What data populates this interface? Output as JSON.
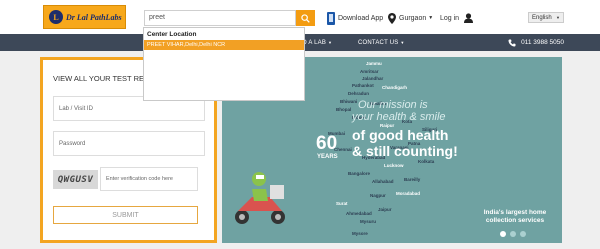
{
  "header": {
    "logo_text": "Dr Lal PathLabs",
    "search_value": "preet",
    "download_label": "Download App",
    "location_label": "Gurgaon",
    "login_label": "Log in",
    "language_selected": "English"
  },
  "dropdown": {
    "heading": "Center Location",
    "items": [
      "PREET VIHAR,Delhi,Delhi NCR"
    ]
  },
  "nav": {
    "items": [
      "O A LAB",
      "CONTACT US"
    ],
    "phone": "011 3988 5050"
  },
  "report_form": {
    "title": "VIEW ALL YOUR TEST REPORTS",
    "lab_placeholder": "Lab / Visit ID",
    "password_placeholder": "Password",
    "captcha_text": "QWGUSV",
    "captcha_placeholder": "Enter verification code here",
    "submit_label": "SUBMIT"
  },
  "banner": {
    "line1": "Our mission is",
    "line2": "your health & smile",
    "big_number": "60",
    "years_label": "YEARS",
    "line3": "of good health",
    "line4": "& still counting!",
    "promo_line1": "India's largest home",
    "promo_line2": "collection services",
    "cities": [
      "Jammu",
      "Amritsar",
      "Jalandhar",
      "Pathankot",
      "Dehradun",
      "Chandigarh",
      "Bhiwani",
      "Bhopal",
      "Indore",
      "Gwalior",
      "Raipur",
      "Mumbai",
      "Chennai",
      "Hyderabad",
      "Bangalore",
      "Lucknow",
      "Allahabad",
      "Patna",
      "Kolkata",
      "Nagpur",
      "Surat",
      "Ahmedabad",
      "Mysuru",
      "Jaipur",
      "Bareilly",
      "Moradabad",
      "Varanasi",
      "Siliguri",
      "Kota",
      "Mysore"
    ]
  },
  "colors": {
    "accent": "#f39c12",
    "nav_bg": "#3d4858",
    "banner_bg": "#6fa2a2",
    "logo_bg": "#f7a81b"
  },
  "icons": [
    "search-icon",
    "phone-icon",
    "location-pin-icon",
    "user-icon",
    "chevron-down-icon",
    "call-icon"
  ]
}
